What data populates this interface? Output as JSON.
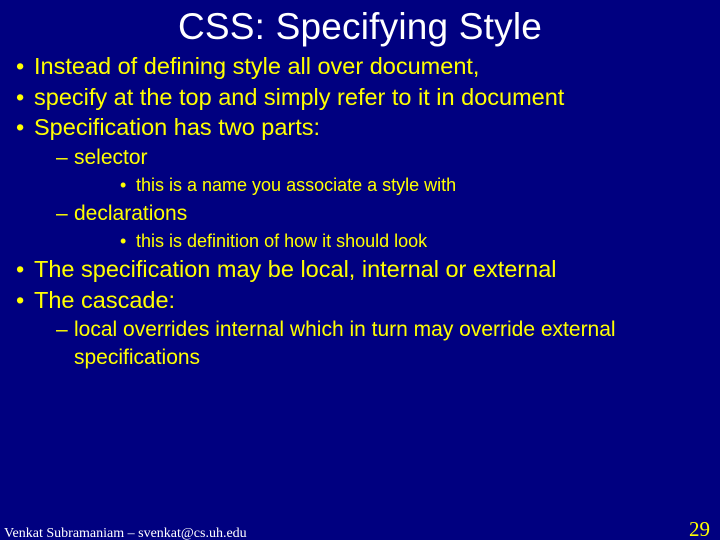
{
  "title": "CSS: Specifying Style",
  "bullets": {
    "b1": "Instead of defining style all over document,",
    "b2": "specify at the top and simply refer to it in document",
    "b3": "Specification has two parts:",
    "b3a": "selector",
    "b3a1": "this is a name you associate a style with",
    "b3b": "declarations",
    "b3b1": "this is definition of how it should look",
    "b4": "The specification may be local, internal or external",
    "b5": "The cascade:",
    "b5a": "local overrides internal which in turn may override external specifications"
  },
  "footer": {
    "author": "Venkat Subramaniam – svenkat@cs.uh.edu",
    "page": "29"
  }
}
